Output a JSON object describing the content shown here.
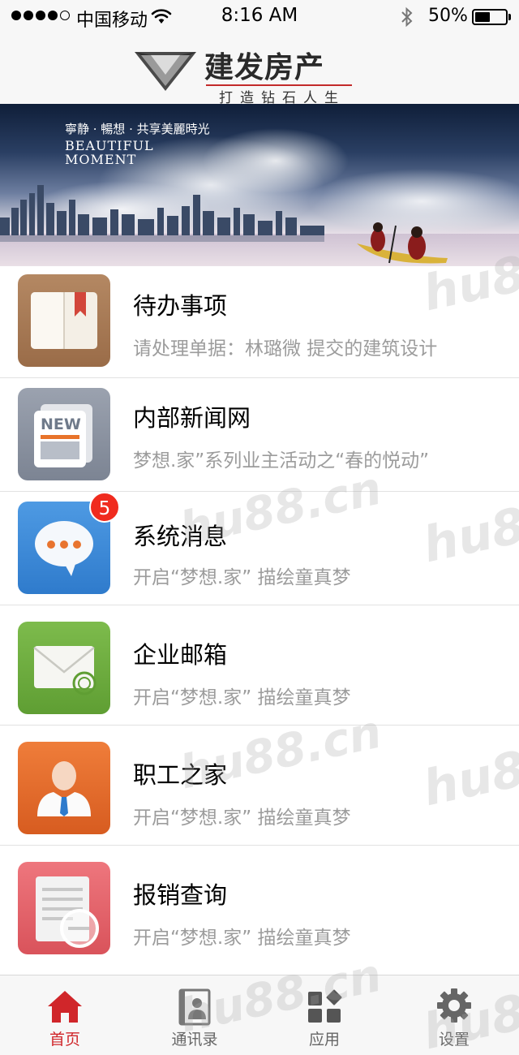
{
  "status_bar": {
    "carrier": "中国移动",
    "time": "8:16 AM",
    "battery_percent": "50%",
    "battery_level": 0.5,
    "signal_strength": 4
  },
  "header": {
    "logo_name": "建发房产",
    "logo_slogan": "打造钻石人生",
    "logo_icon": "diamond-icon"
  },
  "banner": {
    "caption": "寧静 · 暢想 · 共享美麗時光",
    "title": "BEAUTIFUL MOMENT"
  },
  "list": [
    {
      "title": "待办事项",
      "subtitle": "请处理单据：林璐微 提交的建筑设计",
      "icon": "book-icon",
      "color": "#a87a55"
    },
    {
      "title": "内部新闻网",
      "subtitle": "梦想.家”系列业主活动之“春的悦动”",
      "icon": "newspaper-icon",
      "color": "#8c94a3",
      "icon_text": "NEW"
    },
    {
      "title": "系统消息",
      "subtitle": "开启“梦想.家” 描绘童真梦",
      "icon": "chat-bubble-icon",
      "color": "#3c8ad8",
      "badge": "5"
    },
    {
      "title": "企业邮箱",
      "subtitle": "开启“梦想.家” 描绘童真梦",
      "icon": "envelope-icon",
      "color": "#6aab3b"
    },
    {
      "title": "职工之家",
      "subtitle": "开启“梦想.家” 描绘童真梦",
      "icon": "person-icon",
      "color": "#e46b2a"
    },
    {
      "title": "报销查询",
      "subtitle": "开启“梦想.家” 描绘童真梦",
      "icon": "document-search-icon",
      "color": "#e8636b"
    }
  ],
  "tabbar": {
    "tabs": [
      {
        "label": "首页",
        "icon": "home-icon",
        "active": true
      },
      {
        "label": "通讯录",
        "icon": "contacts-icon",
        "active": false
      },
      {
        "label": "应用",
        "icon": "apps-icon",
        "active": false
      },
      {
        "label": "设置",
        "icon": "gear-icon",
        "active": false
      }
    ]
  },
  "watermark": "hu88.cn",
  "colors": {
    "accent": "#d0262a",
    "badge": "#f02b1e",
    "subtitle": "#9c9c9c"
  }
}
